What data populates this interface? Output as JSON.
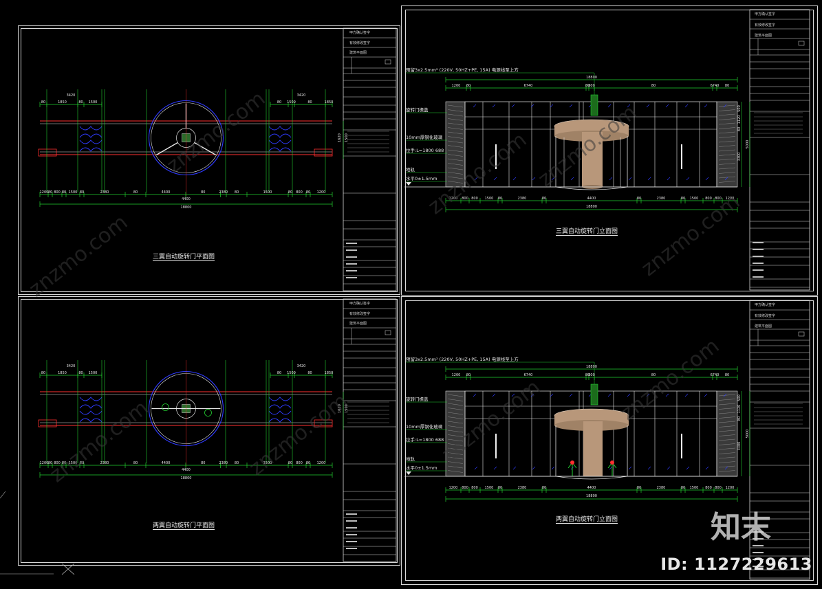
{
  "panels": [
    {
      "id": "p1",
      "caption": "三翼自动旋转门平面图"
    },
    {
      "id": "p2",
      "caption": "三翼自动旋转门立面图"
    },
    {
      "id": "p3",
      "caption": "两翼自动旋转门平面图"
    },
    {
      "id": "p4",
      "caption": "两翼自动旋转门立面图"
    }
  ],
  "plan_dims": {
    "top_left": [
      "3420",
      "80",
      "1850",
      "80",
      "1500",
      "80"
    ],
    "top_right": [
      "3420",
      "80",
      "1500",
      "80",
      "1850",
      "80"
    ],
    "bottom": [
      "1200",
      "80",
      "800",
      "80",
      "1500",
      "80",
      "2380",
      "80",
      "4400",
      "80",
      "2380",
      "80",
      "1500",
      "80",
      "800",
      "80",
      "1200"
    ],
    "overall_mid": "4400",
    "overall": "18800",
    "side": [
      "1620",
      "1500"
    ]
  },
  "elev_dims": {
    "overall_top": "18800",
    "top": [
      "1200",
      "80",
      "6740",
      "80",
      "600",
      "80",
      "6740",
      "80",
      "1200"
    ],
    "bottom": [
      "1200",
      "800",
      "800",
      "1500",
      "80",
      "2380",
      "80",
      "4400",
      "80",
      "2380",
      "80",
      "1500",
      "800",
      "800",
      "1200"
    ],
    "right": [
      "500",
      "1120",
      "80",
      "3300",
      "5000"
    ],
    "notes": [
      "预留3x2.5mm² (220V, 50HZ+PE, 15A) 电源线至上方",
      "旋转门檐盖",
      "10mm厚钢化玻璃",
      "拉手:L=1800 688",
      "地轨",
      "水平0±1.5mm"
    ]
  },
  "title_block": {
    "header": [
      "甲方确认签字",
      "有效修改签字",
      "建筑平面图"
    ],
    "notes_title": "说明",
    "rows": [
      "工程名称",
      "子项",
      "图名",
      "设计人",
      "校对人",
      "审核人",
      "审定人",
      "比例",
      "日期",
      "图号"
    ]
  },
  "overlay": {
    "logo": "知末",
    "id": "ID: 1127229613"
  },
  "colors": {
    "green": "#22d130",
    "red": "#ff3030",
    "blue": "#2f3bff",
    "white": "#e8e8e8",
    "bronze": "#b8977a"
  }
}
